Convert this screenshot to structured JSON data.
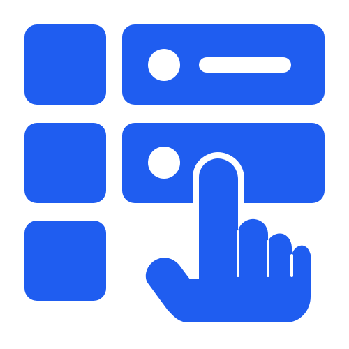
{
  "icon": {
    "name": "list-tap-icon",
    "color": "#1f5df0",
    "background": "#ffffff",
    "tiles": [
      {
        "name": "grid-tile-1"
      },
      {
        "name": "grid-tile-2"
      },
      {
        "name": "grid-tile-3"
      }
    ],
    "rows": [
      {
        "name": "list-row-1",
        "has_line": true
      },
      {
        "name": "list-row-2",
        "has_line": false
      }
    ],
    "hand": {
      "name": "pointing-hand-icon"
    }
  }
}
